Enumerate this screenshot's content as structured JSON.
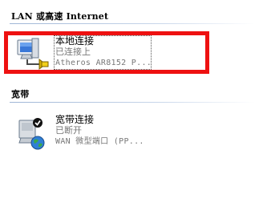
{
  "groups": {
    "lan": {
      "header": "LAN 或高速 Internet"
    },
    "broadband": {
      "header": "宽带"
    }
  },
  "connections": [
    {
      "name": "本地连接",
      "status": "已连接上",
      "device": "Atheros AR8152 P...",
      "icon": "lan-connection-icon",
      "selected": true
    },
    {
      "name": "宽带连接",
      "status": "已断开",
      "device": "WAN 微型端口 (PP...",
      "icon": "broadband-connection-icon",
      "selected": false
    }
  ],
  "colors": {
    "selection_border": "#ee1111",
    "secondary_text": "#777777",
    "group_line": "#9fb6d6"
  }
}
